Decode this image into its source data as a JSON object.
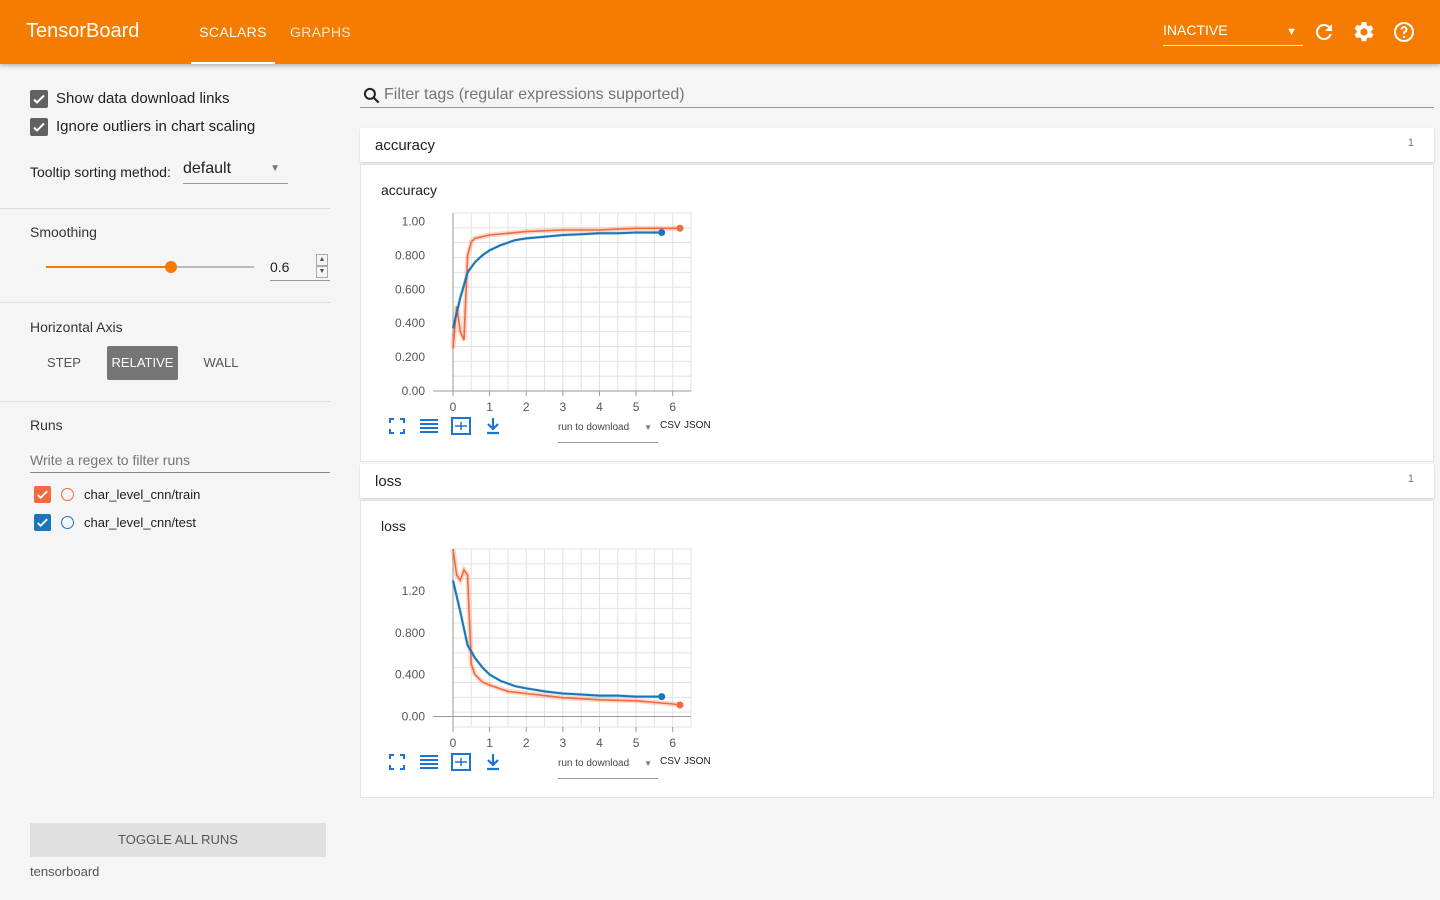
{
  "app": {
    "title": "TensorBoard",
    "tabs": [
      {
        "label": "SCALARS",
        "active": true
      },
      {
        "label": "GRAPHS",
        "active": false
      }
    ],
    "status_select": "INACTIVE",
    "accent": "#f57c00",
    "icons": [
      "refresh-icon",
      "settings-icon",
      "help-icon"
    ]
  },
  "sidebar": {
    "options": [
      {
        "label": "Show data download links",
        "checked": true
      },
      {
        "label": "Ignore outliers in chart scaling",
        "checked": true
      }
    ],
    "tooltip_sorting_label": "Tooltip sorting method:",
    "tooltip_sorting_value": "default",
    "smoothing_label": "Smoothing",
    "smoothing_value": "0.6",
    "horizontal_axis_label": "Horizontal Axis",
    "axis_buttons": [
      {
        "label": "STEP"
      },
      {
        "label": "RELATIVE",
        "active": true
      },
      {
        "label": "WALL"
      }
    ],
    "runs_label": "Runs",
    "runs_filter_placeholder": "Write a regex to filter runs",
    "runs": [
      {
        "name": "char_level_cnn/train",
        "color": "#f26a3d",
        "checked": true
      },
      {
        "name": "char_level_cnn/test",
        "color": "#1976b8",
        "checked": true
      }
    ],
    "toggle_all_label": "TOGGLE ALL RUNS",
    "footer_label": "tensorboard"
  },
  "main": {
    "filter_placeholder": "Filter tags (regular expressions supported)",
    "cards": [
      {
        "title": "accuracy",
        "count": "1",
        "chart_title": "accuracy",
        "run_select": "run to download",
        "csv": "CSV",
        "json": "JSON"
      },
      {
        "title": "loss",
        "count": "1",
        "chart_title": "loss",
        "run_select": "run to download",
        "csv": "CSV",
        "json": "JSON"
      }
    ]
  },
  "chart_data": [
    {
      "type": "line",
      "title": "accuracy",
      "xlim": [
        0,
        6.5
      ],
      "ylim": [
        0,
        1.05
      ],
      "x_ticks": [
        "0",
        "1",
        "2",
        "3",
        "4",
        "5",
        "6"
      ],
      "y_ticks": [
        "0.00",
        "0.200",
        "0.400",
        "0.600",
        "0.800",
        "1.00"
      ],
      "grid": true,
      "series": [
        {
          "name": "char_level_cnn/train",
          "color": "#f26a3d",
          "x": [
            0,
            0.1,
            0.2,
            0.3,
            0.4,
            0.5,
            0.6,
            0.8,
            1.0,
            1.5,
            2.0,
            3.0,
            4.0,
            5.0,
            6.0,
            6.2
          ],
          "y": [
            0.25,
            0.5,
            0.35,
            0.3,
            0.8,
            0.88,
            0.9,
            0.91,
            0.92,
            0.93,
            0.94,
            0.95,
            0.95,
            0.96,
            0.96,
            0.96
          ]
        },
        {
          "name": "char_level_cnn/test",
          "color": "#1976b8",
          "x": [
            0,
            0.2,
            0.4,
            0.6,
            0.8,
            1.0,
            1.3,
            1.7,
            2.0,
            2.5,
            3.0,
            3.5,
            4.0,
            4.5,
            5.0,
            5.5,
            5.7
          ],
          "y": [
            0.37,
            0.55,
            0.7,
            0.76,
            0.8,
            0.83,
            0.86,
            0.89,
            0.9,
            0.91,
            0.92,
            0.925,
            0.93,
            0.93,
            0.935,
            0.935,
            0.935
          ]
        }
      ]
    },
    {
      "type": "line",
      "title": "loss",
      "xlim": [
        0,
        6.5
      ],
      "ylim": [
        -0.1,
        1.6
      ],
      "x_ticks": [
        "0",
        "1",
        "2",
        "3",
        "4",
        "5",
        "6"
      ],
      "y_ticks": [
        "0.00",
        "0.400",
        "0.800",
        "1.20"
      ],
      "grid": true,
      "series": [
        {
          "name": "char_level_cnn/train",
          "color": "#f26a3d",
          "x": [
            0,
            0.1,
            0.2,
            0.3,
            0.4,
            0.5,
            0.6,
            0.8,
            1.0,
            1.5,
            2.0,
            3.0,
            4.0,
            5.0,
            6.0,
            6.2
          ],
          "y": [
            1.6,
            1.35,
            1.3,
            1.4,
            1.35,
            0.5,
            0.4,
            0.33,
            0.3,
            0.24,
            0.22,
            0.18,
            0.16,
            0.15,
            0.12,
            0.11
          ]
        },
        {
          "name": "char_level_cnn/test",
          "color": "#1976b8",
          "x": [
            0,
            0.2,
            0.4,
            0.6,
            0.8,
            1.0,
            1.3,
            1.7,
            2.0,
            2.5,
            3.0,
            3.5,
            4.0,
            4.5,
            5.0,
            5.5,
            5.7
          ],
          "y": [
            1.3,
            1.0,
            0.68,
            0.56,
            0.47,
            0.4,
            0.34,
            0.29,
            0.27,
            0.24,
            0.22,
            0.21,
            0.2,
            0.2,
            0.19,
            0.19,
            0.19
          ]
        }
      ]
    }
  ]
}
